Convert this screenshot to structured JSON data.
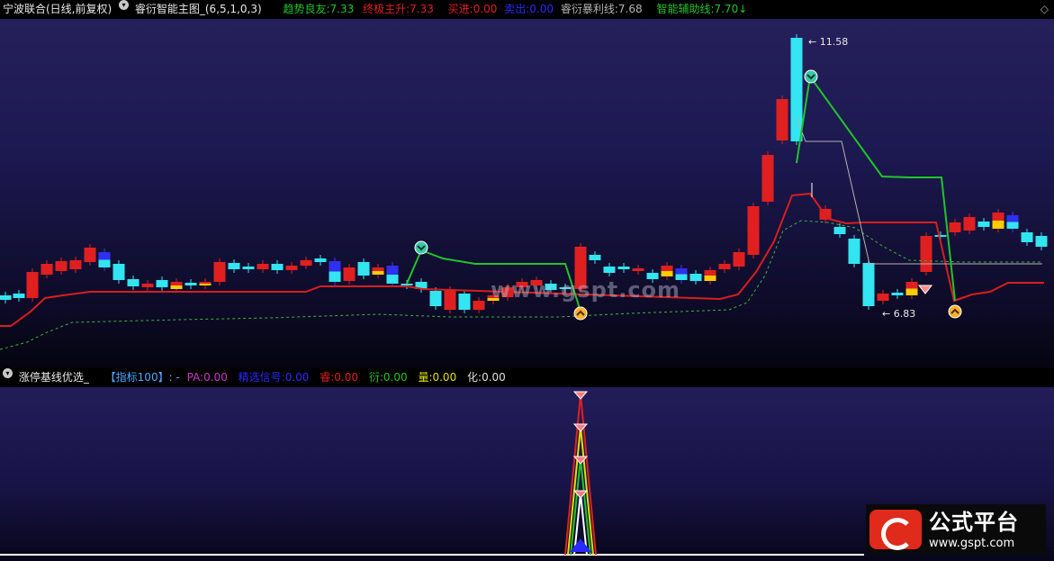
{
  "header": {
    "stock": "宁波联合(日线,前复权)",
    "indicator": "睿衍智能主图_(6,5,1,0,3)",
    "legend": [
      {
        "label": "趋势良友:",
        "value": "7.33",
        "color": "#22c42a"
      },
      {
        "label": "终极主升:",
        "value": "7.33",
        "color": "#e02020"
      },
      {
        "label": "买进:",
        "value": "0.00",
        "color": "#e02020"
      },
      {
        "label": "卖出:",
        "value": "0.00",
        "color": "#2a2aff"
      },
      {
        "label": "睿衍暴利线:",
        "value": "7.68",
        "color": "#b4b4b4"
      },
      {
        "label": "智能辅助线:",
        "value": "7.70",
        "color": "#22c42a"
      }
    ],
    "arrow": "↓",
    "corner_icon": "diamond-icon"
  },
  "price_labels": {
    "high": "11.58",
    "low": "6.83"
  },
  "sub_header": {
    "indicator": "涨停基线优选_",
    "title_label": "【指标100】: -",
    "legend": [
      {
        "label": "PA:",
        "value": "0.00",
        "color": "#c83ac8"
      },
      {
        "label": "精选信号:",
        "value": "0.00",
        "color": "#2a2aff"
      },
      {
        "label": "睿:",
        "value": "0.00",
        "color": "#e02020"
      },
      {
        "label": "衍:",
        "value": "0.00",
        "color": "#22c42a"
      },
      {
        "label": "量:",
        "value": "0.00",
        "color": "#e0e000"
      },
      {
        "label": "化:",
        "value": "0.00",
        "color": "#e0e0e0"
      }
    ]
  },
  "watermark": "www.gspt.com",
  "logo": {
    "title": "公式平台",
    "url": "www.gspt.com"
  },
  "colors": {
    "up": "#e02020",
    "down": "#33e5f0",
    "trend": "#22c42a",
    "support": "#d81e1e",
    "dashed": "#3fb33f",
    "profit": "#b4b4b4"
  }
}
